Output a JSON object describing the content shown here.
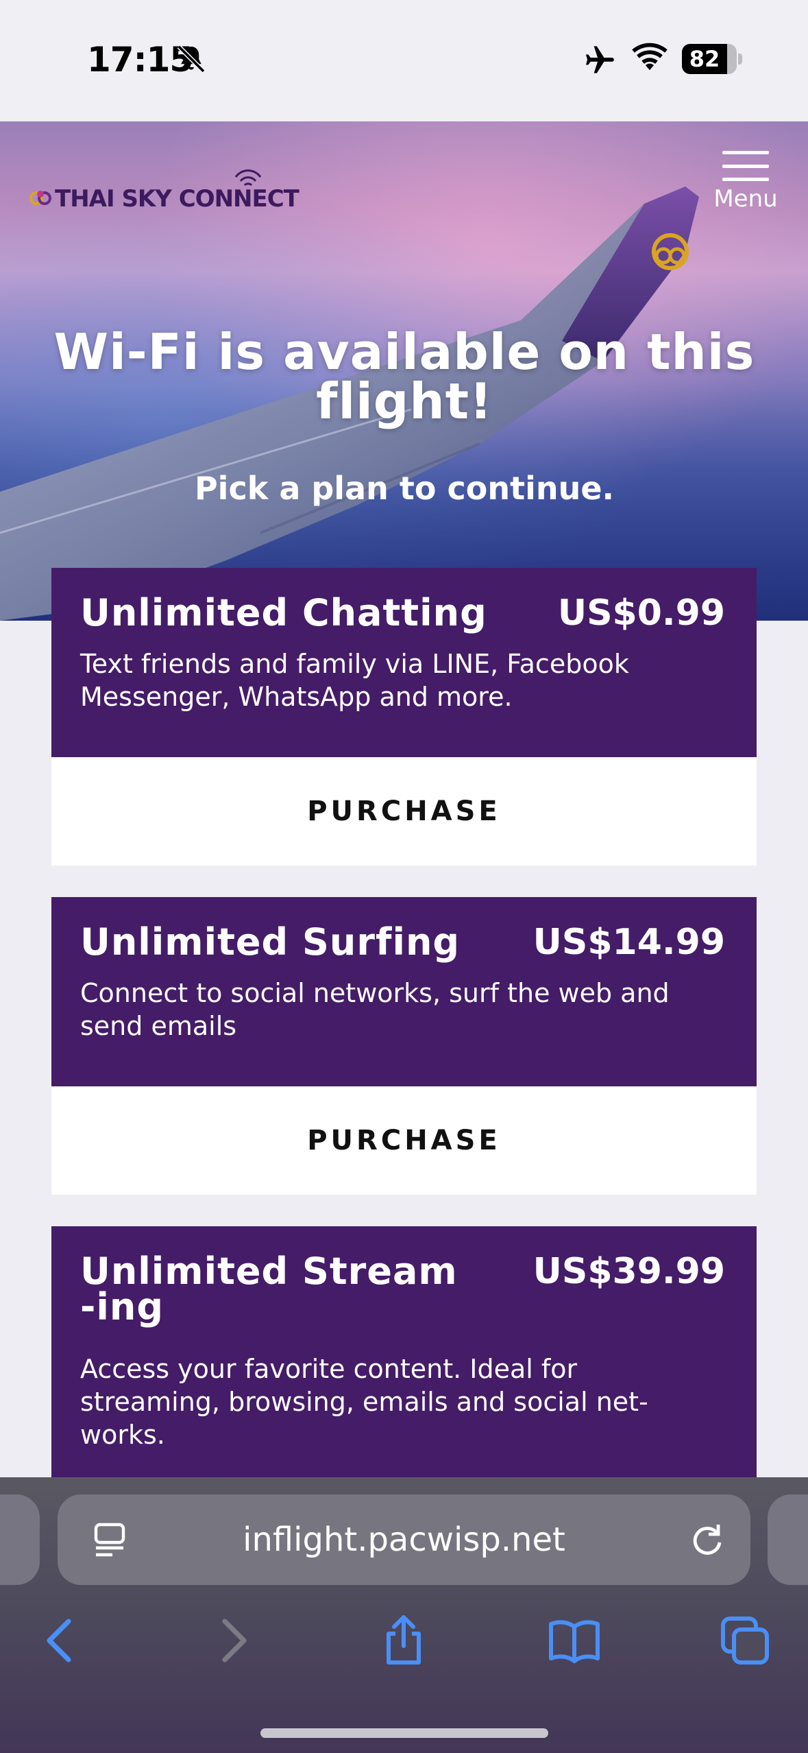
{
  "status_bar": {
    "time": "17:15",
    "battery_level": "82",
    "battery_fraction": 0.82,
    "icons": [
      "bell-slash-icon",
      "airplane-icon",
      "wifi-icon",
      "battery-icon"
    ]
  },
  "header": {
    "logo_text": "THAI SKY CONNECT",
    "menu_label": "Menu"
  },
  "hero": {
    "title": "Wi-Fi is available on this flight!",
    "subtitle": "Pick a plan to continue."
  },
  "plans": [
    {
      "name": "Unlimited Chatting",
      "price": "US$0.99",
      "description": "Text friends and family via LINE, Facebook Messenger, WhatsApp and more.",
      "button_label": "PURCHASE"
    },
    {
      "name": "Unlimited Surfing",
      "price": "US$14.99",
      "description": "Connect to social networks, surf the web and send emails",
      "button_label": "PURCHASE"
    },
    {
      "name": "Unlimited Stream-ing",
      "price": "US$39.99",
      "description": "Access your favorite content. Ideal for streaming, browsing, emails and social net-works."
    }
  ],
  "browser": {
    "url": "inflight.pacwisp.net",
    "toolbar_icons": [
      "back-icon",
      "forward-icon",
      "share-icon",
      "bookmarks-icon",
      "tabs-icon"
    ]
  },
  "colors": {
    "plan_background": "#451c68",
    "accent_blue": "#4a8ff5",
    "logo_purple": "#3d1a5e",
    "logo_gold": "#d9a521"
  }
}
